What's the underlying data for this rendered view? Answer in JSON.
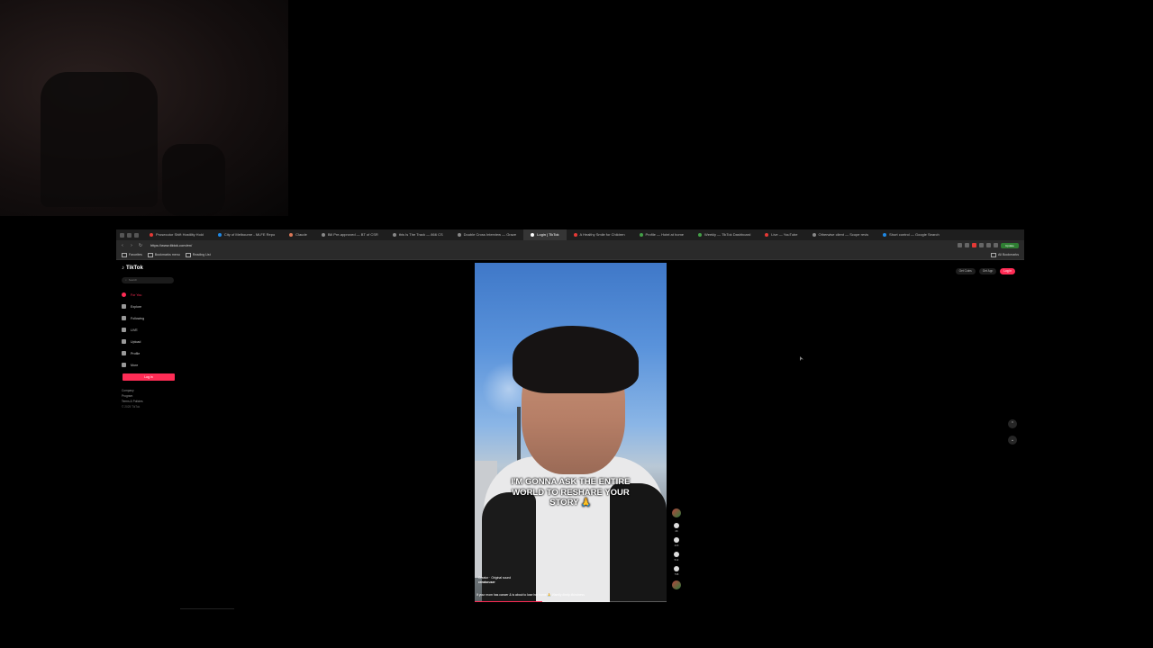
{
  "browser": {
    "tabs": [
      {
        "label": "Prosecutor Shift Hostility Hold",
        "color": "#e53935"
      },
      {
        "label": "City of Melbourne - MLFE Repo",
        "color": "#1e88e5"
      },
      {
        "label": "Claude",
        "color": "#d97757"
      },
      {
        "label": "Bill Pre-approved — BT of CSR",
        "color": "#888888"
      },
      {
        "label": "this Is The Track — 866 CS",
        "color": "#888888"
      },
      {
        "label": "Double Cross Interview — Graze",
        "color": "#888888"
      },
      {
        "label": "Login | TikTok",
        "color": "#ffffff",
        "active": true
      },
      {
        "label": "A Healthy Smile for Children",
        "color": "#e53935"
      },
      {
        "label": "Profile — Hotel at home",
        "color": "#43a047"
      },
      {
        "label": "Weekly — TikTok Dashboard",
        "color": "#43a047"
      },
      {
        "label": "Live — YouTube",
        "color": "#e53935"
      },
      {
        "label": "Otherwise client — Scope revis",
        "color": "#888888"
      },
      {
        "label": "Short control — Google Search",
        "color": "#1e88e5"
      }
    ],
    "url": "https://www.tiktok.com/en/",
    "update_label": "Update",
    "bookmarks": [
      "Favorites",
      "Bookmarks menu",
      "Reading List"
    ],
    "all_bookmarks_label": "All Bookmarks"
  },
  "tiktok": {
    "logo_text": "TikTok",
    "search_placeholder": "Search",
    "nav_items": [
      {
        "label": "For You",
        "icon": "home-icon",
        "active": true
      },
      {
        "label": "Explore",
        "icon": "compass-icon"
      },
      {
        "label": "Following",
        "icon": "following-icon"
      },
      {
        "label": "LIVE",
        "icon": "live-icon"
      },
      {
        "label": "Upload",
        "icon": "upload-icon"
      },
      {
        "label": "Profile",
        "icon": "profile-icon"
      },
      {
        "label": "More",
        "icon": "more-icon"
      }
    ],
    "login_button": "Log in",
    "footer": {
      "company": "Company",
      "program": "Program",
      "terms": "Terms & Policies",
      "copyright": "© 2025 TikTok"
    },
    "top_right": {
      "get_coins": "Get Coins",
      "get_app": "Get App",
      "login": "Log in"
    },
    "video": {
      "caption": "I'M GONNA ASK THE ENTIRE WORLD TO RESHARE YOUR STORY 🙏",
      "sound": "Creator · Original sound",
      "username": "creatoruser",
      "description": "If your mom has cancer & is about to lose her home 🙏 #family #help #kindness"
    },
    "actions": [
      {
        "icon": "heart-icon",
        "count": "4K"
      },
      {
        "icon": "comment-icon",
        "count": "420"
      },
      {
        "icon": "bookmark-icon",
        "count": "512"
      },
      {
        "icon": "share-icon",
        "count": "798"
      }
    ],
    "progress": 0.35
  }
}
